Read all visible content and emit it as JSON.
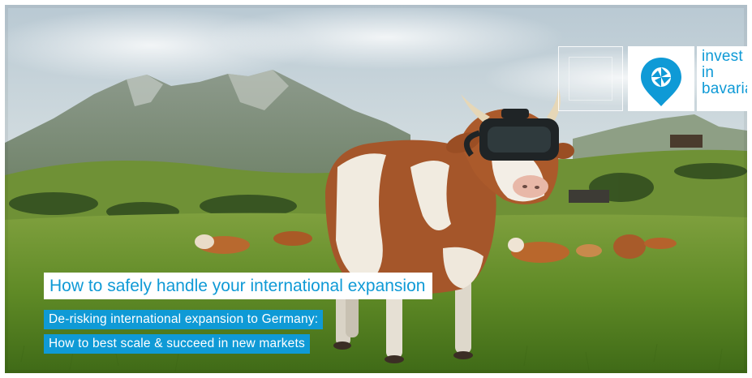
{
  "brand": {
    "line1": "invest",
    "line2": "in",
    "line3": "bavaria",
    "color": "#0f9ad6"
  },
  "banner": {
    "headline": "How to safely handle your international expansion",
    "subtitle_line1": "De-risking international expansion to Germany:",
    "subtitle_line2": "How to best scale & succeed in new markets"
  },
  "icons": {
    "seal": "seal-emblem-icon",
    "logo": "camera-aperture-pin-icon"
  }
}
